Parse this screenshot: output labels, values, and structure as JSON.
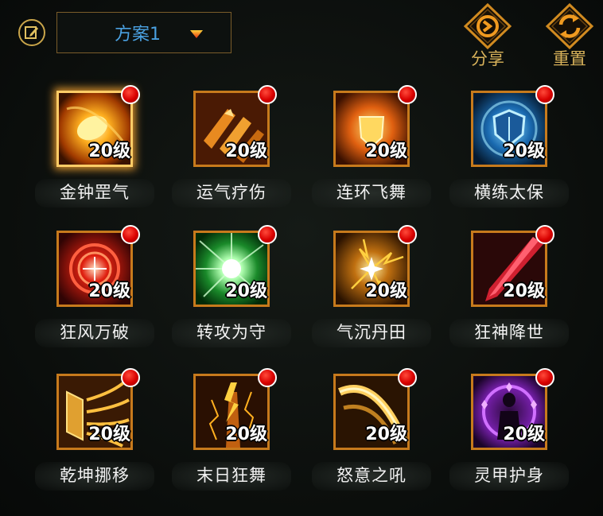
{
  "header": {
    "plan_label": "方案1",
    "share_label": "分享",
    "reset_label": "重置"
  },
  "colors": {
    "accent_gold": "#d8b25a",
    "plan_text": "#4aa0e0",
    "frame_orange": "#c77a1c",
    "red_dot": "#d80000"
  },
  "skills": [
    {
      "name": "金钟罡气",
      "level": "20级",
      "icon": "golden-bell-icon",
      "selected": true
    },
    {
      "name": "运气疗伤",
      "level": "20级",
      "icon": "heal-qi-icon",
      "selected": false
    },
    {
      "name": "连环飞舞",
      "level": "20级",
      "icon": "chain-dance-icon",
      "selected": false
    },
    {
      "name": "横练太保",
      "level": "20级",
      "icon": "shield-icon",
      "selected": false
    },
    {
      "name": "狂风万破",
      "level": "20级",
      "icon": "storm-break-icon",
      "selected": false
    },
    {
      "name": "转攻为守",
      "level": "20级",
      "icon": "green-burst-icon",
      "selected": false
    },
    {
      "name": "气沉丹田",
      "level": "20级",
      "icon": "lightning-spark-icon",
      "selected": false
    },
    {
      "name": "狂神降世",
      "level": "20级",
      "icon": "blade-icon",
      "selected": false
    },
    {
      "name": "乾坤挪移",
      "level": "20级",
      "icon": "golden-claw-icon",
      "selected": false
    },
    {
      "name": "末日狂舞",
      "level": "20级",
      "icon": "lightning-pillar-icon",
      "selected": false
    },
    {
      "name": "怒意之吼",
      "level": "20级",
      "icon": "slash-wave-icon",
      "selected": false
    },
    {
      "name": "灵甲护身",
      "level": "20级",
      "icon": "purple-aura-icon",
      "selected": false
    }
  ]
}
